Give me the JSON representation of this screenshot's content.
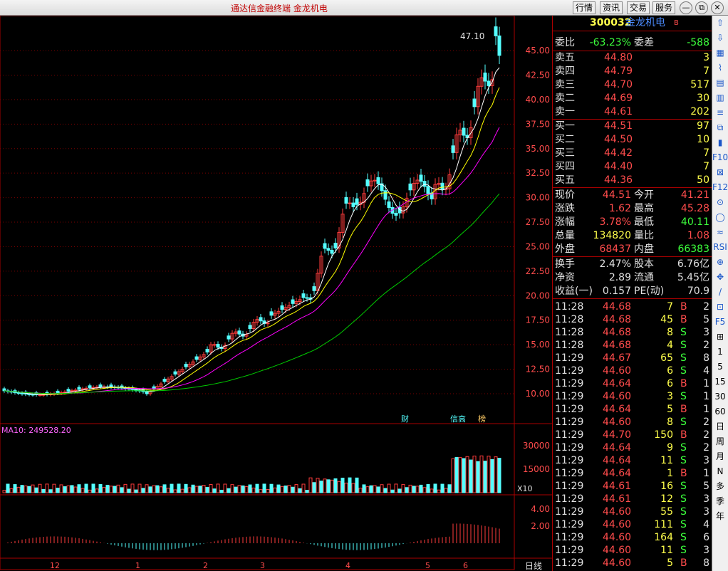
{
  "topbar": {
    "title": "通达信金融终端    金龙机电",
    "buttons": [
      "行情",
      "资讯",
      "交易",
      "服务"
    ],
    "window_buttons": [
      "—",
      "⧉",
      "✕"
    ]
  },
  "stock": {
    "code": "300032",
    "name": "金龙机电",
    "badge": "B"
  },
  "weibi": {
    "label": "委比",
    "value": "-63.23%",
    "label2": "委差",
    "value2": "-588"
  },
  "asks": [
    {
      "label": "卖五",
      "price": "44.80",
      "vol": "3"
    },
    {
      "label": "卖四",
      "price": "44.79",
      "vol": "7"
    },
    {
      "label": "卖三",
      "price": "44.70",
      "vol": "517"
    },
    {
      "label": "卖二",
      "price": "44.69",
      "vol": "30"
    },
    {
      "label": "卖一",
      "price": "44.61",
      "vol": "202"
    }
  ],
  "bids": [
    {
      "label": "买一",
      "price": "44.51",
      "vol": "97"
    },
    {
      "label": "买二",
      "price": "44.50",
      "vol": "10"
    },
    {
      "label": "买三",
      "price": "44.42",
      "vol": "7"
    },
    {
      "label": "买四",
      "price": "44.40",
      "vol": "7"
    },
    {
      "label": "买五",
      "price": "44.36",
      "vol": "50"
    }
  ],
  "quote": [
    {
      "l1": "现价",
      "v1": "44.51",
      "l2": "今开",
      "v2": "41.21"
    },
    {
      "l1": "涨跌",
      "v1": "1.62",
      "l2": "最高",
      "v2": "45.28"
    },
    {
      "l1": "涨幅",
      "v1": "3.78%",
      "l2": "最低",
      "v2": "40.11"
    },
    {
      "l1": "总量",
      "v1": "134820",
      "l2": "量比",
      "v2": "1.08"
    },
    {
      "l1": "外盘",
      "v1": "68437",
      "l2": "内盘",
      "v2": "66383"
    }
  ],
  "stats": [
    {
      "l1": "换手",
      "v1": "2.47%",
      "l2": "股本",
      "v2": "6.76亿"
    },
    {
      "l1": "净资",
      "v1": "2.89",
      "l2": "流通",
      "v2": "5.45亿"
    },
    {
      "l1": "收益(一)",
      "v1": "0.157",
      "l2": "PE(动)",
      "v2": "70.9"
    }
  ],
  "ticks": [
    [
      "11:28",
      "44.68",
      "7",
      "B",
      "2"
    ],
    [
      "11:28",
      "44.68",
      "45",
      "B",
      "5"
    ],
    [
      "11:28",
      "44.68",
      "8",
      "S",
      "3"
    ],
    [
      "11:28",
      "44.68",
      "4",
      "S",
      "2"
    ],
    [
      "11:29",
      "44.67",
      "65",
      "S",
      "8"
    ],
    [
      "11:29",
      "44.60",
      "6",
      "S",
      "4"
    ],
    [
      "11:29",
      "44.64",
      "6",
      "B",
      "1"
    ],
    [
      "11:29",
      "44.60",
      "3",
      "S",
      "1"
    ],
    [
      "11:29",
      "44.64",
      "5",
      "B",
      "1"
    ],
    [
      "11:29",
      "44.60",
      "8",
      "S",
      "2"
    ],
    [
      "11:29",
      "44.70",
      "150",
      "B",
      "2"
    ],
    [
      "11:29",
      "44.64",
      "9",
      "S",
      "2"
    ],
    [
      "11:29",
      "44.64",
      "11",
      "S",
      "3"
    ],
    [
      "11:29",
      "44.64",
      "1",
      "B",
      "1"
    ],
    [
      "11:29",
      "44.61",
      "16",
      "S",
      "5"
    ],
    [
      "11:29",
      "44.61",
      "12",
      "S",
      "3"
    ],
    [
      "11:29",
      "44.60",
      "55",
      "S",
      "3"
    ],
    [
      "11:29",
      "44.60",
      "111",
      "S",
      "4"
    ],
    [
      "11:29",
      "44.60",
      "164",
      "S",
      "6"
    ],
    [
      "11:29",
      "44.60",
      "11",
      "S",
      "3"
    ],
    [
      "11:29",
      "44.60",
      "5",
      "B",
      "8"
    ]
  ],
  "chart": {
    "high_label": "47.10",
    "price_ticks": [
      "45.00",
      "42.50",
      "40.00",
      "37.50",
      "35.00",
      "32.50",
      "30.00",
      "27.50",
      "25.00",
      "22.50",
      "20.00",
      "17.50",
      "15.00",
      "12.50",
      "10.00"
    ],
    "vol_label": "MA10: 249528.20",
    "vol_ticks": [
      "30000",
      "15000"
    ],
    "vol_unit": "X10",
    "macd_ticks": [
      "4.00",
      "2.00"
    ],
    "months": [
      "12",
      "1",
      "2",
      "3",
      "4",
      "5",
      "6"
    ],
    "period": "日线",
    "markers": [
      "财",
      "信高",
      "榜"
    ]
  },
  "sidebar": [
    "⇧",
    "⇩",
    "▦",
    "⌇",
    "▤",
    "▥",
    "≡",
    "⧉",
    "▮",
    "F10",
    "⊠",
    "F12",
    "⊙",
    "◯",
    "≈",
    "RSI",
    "⊕",
    "✥",
    "/",
    "⊡",
    "F5",
    "⊞",
    "1",
    "5",
    "15",
    "30",
    "60",
    "日",
    "周",
    "月",
    "N",
    "多",
    "季",
    "年"
  ],
  "colors": {
    "up": "#ff3c3c",
    "down": "#54ffff",
    "ma5": "#ffffff",
    "ma10": "#ffff00",
    "ma20": "#ff00ff",
    "ma60": "#00cc00"
  }
}
